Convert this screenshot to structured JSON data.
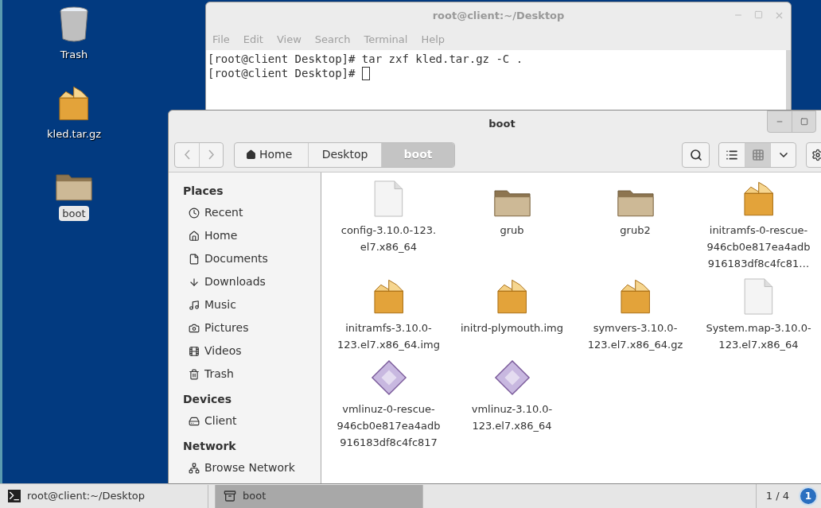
{
  "desktop_icons": [
    {
      "kind": "trash",
      "label": "Trash",
      "selected": false
    },
    {
      "kind": "package",
      "label": "kled.tar.gz",
      "selected": false
    },
    {
      "kind": "folder",
      "label": "boot",
      "selected": true
    }
  ],
  "terminal": {
    "title": "root@client:~/Desktop",
    "menu": [
      "File",
      "Edit",
      "View",
      "Search",
      "Terminal",
      "Help"
    ],
    "lines": [
      "[root@client Desktop]# tar zxf kled.tar.gz -C .",
      "[root@client Desktop]# "
    ]
  },
  "file_manager": {
    "title": "boot",
    "path": [
      {
        "label": "Home",
        "kind": "home",
        "selected": false
      },
      {
        "label": "Desktop",
        "kind": "folder",
        "selected": false
      },
      {
        "label": "boot",
        "kind": "folder",
        "selected": true
      }
    ],
    "view_buttons": [
      {
        "kind": "list",
        "selected": false
      },
      {
        "kind": "grid",
        "selected": true
      },
      {
        "kind": "menu",
        "selected": false
      }
    ],
    "sidebar": [
      {
        "heading": "Places",
        "items": [
          {
            "label": "Recent",
            "kind": "recent"
          },
          {
            "label": "Home",
            "kind": "home"
          },
          {
            "label": "Documents",
            "kind": "documents"
          },
          {
            "label": "Downloads",
            "kind": "downloads"
          },
          {
            "label": "Music",
            "kind": "music"
          },
          {
            "label": "Pictures",
            "kind": "pictures"
          },
          {
            "label": "Videos",
            "kind": "videos"
          },
          {
            "label": "Trash",
            "kind": "trash"
          }
        ]
      },
      {
        "heading": "Devices",
        "items": [
          {
            "label": "Client",
            "kind": "drive"
          }
        ]
      },
      {
        "heading": "Network",
        "items": [
          {
            "label": "Browse Network",
            "kind": "network"
          }
        ]
      }
    ],
    "files": [
      {
        "name": "config-3.10.0-123.\nel7.x86_64",
        "kind": "document"
      },
      {
        "name": "grub",
        "kind": "folder"
      },
      {
        "name": "grub2",
        "kind": "folder"
      },
      {
        "name": "initramfs-0-rescue-\n946cb0e817ea4adb\n916183df8c4fc81…",
        "kind": "package"
      },
      {
        "name": "initramfs-3.10.0-\n123.el7.x86_64.img",
        "kind": "package"
      },
      {
        "name": "initrd-plymouth.img",
        "kind": "package"
      },
      {
        "name": "symvers-3.10.0-\n123.el7.x86_64.gz",
        "kind": "package"
      },
      {
        "name": "System.map-3.10.0-\n123.el7.x86_64",
        "kind": "document"
      },
      {
        "name": "vmlinuz-0-rescue-\n946cb0e817ea4adb\n916183df8c4fc817",
        "kind": "executable"
      },
      {
        "name": "vmlinuz-3.10.0-\n123.el7.x86_64",
        "kind": "executable"
      }
    ]
  },
  "taskbar": {
    "tasks": [
      {
        "label": "root@client:~/Desktop",
        "kind": "terminal",
        "selected": false
      },
      {
        "label": "boot",
        "kind": "files",
        "selected": true
      }
    ],
    "workspace": "1 / 4",
    "notifications": "1"
  }
}
